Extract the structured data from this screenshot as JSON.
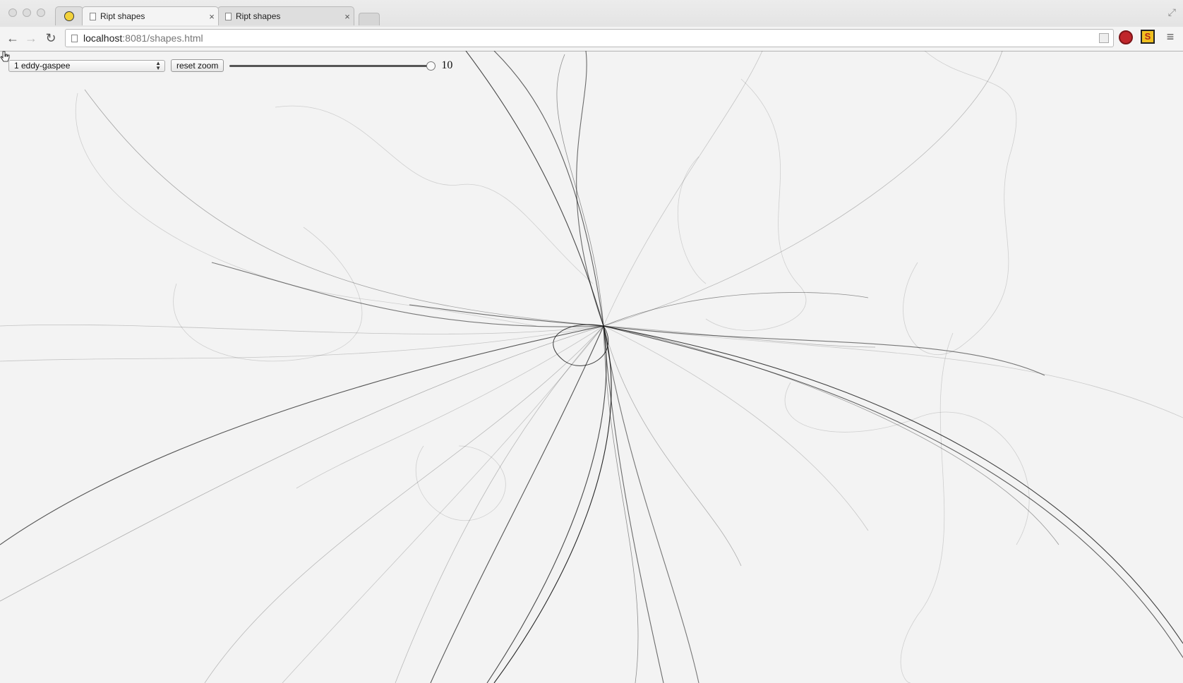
{
  "browser": {
    "pinned_tab": {
      "icon": "lightbulb-icon"
    },
    "tabs": [
      {
        "title": "Ript shapes",
        "active": true
      },
      {
        "title": "Ript shapes",
        "active": false
      }
    ],
    "close_glyph": "×",
    "address": {
      "host": "localhost",
      "path": ":8081/shapes.html"
    },
    "nav": {
      "back": "←",
      "forward": "→",
      "reload": "↻"
    },
    "menu_glyph": "≡",
    "extension_s_label": "S"
  },
  "page": {
    "shape_select": {
      "selected": "1 eddy-gaspee"
    },
    "reset_button": "reset zoom",
    "zoom": {
      "value": "10",
      "fraction": 1.0
    }
  },
  "colors": {
    "page_bg": "#f3f3f3",
    "stroke": "#111111"
  }
}
